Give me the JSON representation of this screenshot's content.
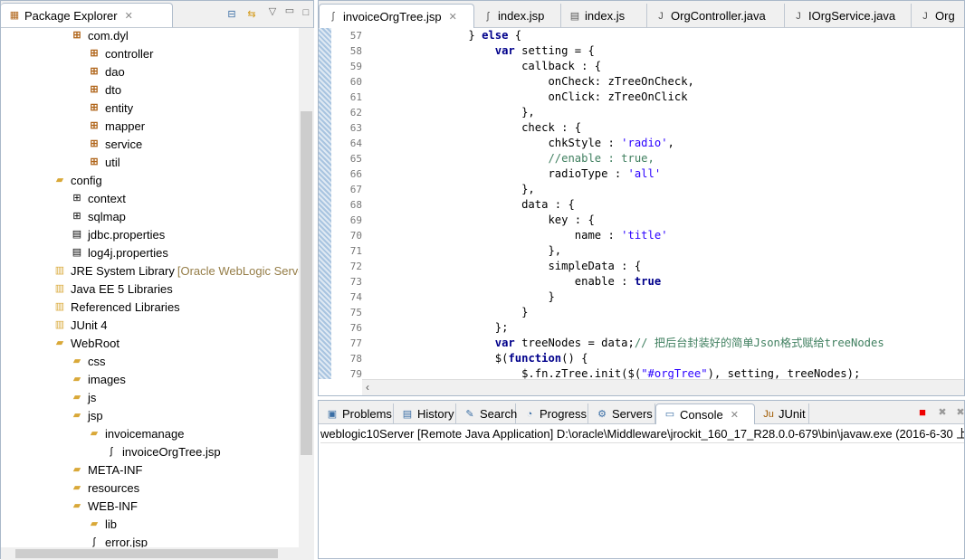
{
  "explorer": {
    "title": "Package Explorer",
    "items": [
      {
        "label": "com.dyl",
        "icon": "package-warning-icon",
        "level": 2
      },
      {
        "label": "controller",
        "icon": "package-icon",
        "level": 3
      },
      {
        "label": "dao",
        "icon": "package-warning-icon",
        "level": 3
      },
      {
        "label": "dto",
        "icon": "package-icon",
        "level": 3
      },
      {
        "label": "entity",
        "icon": "package-icon",
        "level": 3
      },
      {
        "label": "mapper",
        "icon": "package-icon",
        "level": 3
      },
      {
        "label": "service",
        "icon": "package-warning-icon",
        "level": 3
      },
      {
        "label": "util",
        "icon": "package-icon",
        "level": 3
      },
      {
        "label": "config",
        "icon": "source-folder-icon",
        "level": 1
      },
      {
        "label": "context",
        "icon": "folder-package-icon",
        "level": 2
      },
      {
        "label": "sqlmap",
        "icon": "folder-package-icon",
        "level": 2
      },
      {
        "label": "jdbc.properties",
        "icon": "properties-file-icon",
        "level": 2
      },
      {
        "label": "log4j.properties",
        "icon": "properties-file-icon",
        "level": 2
      },
      {
        "label": "JRE System Library",
        "suffix": "[Oracle WebLogic Serve",
        "icon": "library-icon",
        "level": 1
      },
      {
        "label": "Java EE 5 Libraries",
        "icon": "library-icon",
        "level": 1
      },
      {
        "label": "Referenced Libraries",
        "icon": "library-icon",
        "level": 1
      },
      {
        "label": "JUnit 4",
        "icon": "library-icon",
        "level": 1
      },
      {
        "label": "WebRoot",
        "icon": "folder-icon",
        "level": 1
      },
      {
        "label": "css",
        "icon": "folder-icon",
        "level": 2
      },
      {
        "label": "images",
        "icon": "folder-icon",
        "level": 2
      },
      {
        "label": "js",
        "icon": "folder-icon",
        "level": 2
      },
      {
        "label": "jsp",
        "icon": "folder-icon",
        "level": 2
      },
      {
        "label": "invoicemanage",
        "icon": "folder-icon",
        "level": 3
      },
      {
        "label": "invoiceOrgTree.jsp",
        "icon": "jsp-file-icon",
        "level": 4
      },
      {
        "label": "META-INF",
        "icon": "folder-icon",
        "level": 2
      },
      {
        "label": "resources",
        "icon": "folder-icon",
        "level": 2
      },
      {
        "label": "WEB-INF",
        "icon": "folder-icon",
        "level": 2
      },
      {
        "label": "lib",
        "icon": "folder-icon",
        "level": 3
      },
      {
        "label": "error.jsp",
        "icon": "jsp-file-icon",
        "level": 3
      }
    ]
  },
  "editor": {
    "tabs": [
      "invoiceOrgTree.jsp",
      "index.jsp",
      "index.js",
      "OrgController.java",
      "IOrgService.java",
      "Org"
    ],
    "lines": [
      {
        "n": "57",
        "t": [
          [
            "                }",
            "p"
          ],
          [
            " else ",
            "k"
          ],
          [
            "{",
            "p"
          ]
        ]
      },
      {
        "n": "58",
        "t": [
          [
            "                    ",
            "p"
          ],
          [
            "var",
            "k"
          ],
          [
            " setting = {",
            "p"
          ]
        ]
      },
      {
        "n": "59",
        "t": [
          [
            "                        callback : {",
            "p"
          ]
        ]
      },
      {
        "n": "60",
        "t": [
          [
            "                            onCheck: zTreeOnCheck,",
            "p"
          ]
        ]
      },
      {
        "n": "61",
        "t": [
          [
            "                            onClick: zTreeOnClick",
            "p"
          ]
        ]
      },
      {
        "n": "62",
        "t": [
          [
            "                        },",
            "p"
          ]
        ]
      },
      {
        "n": "63",
        "t": [
          [
            "                        check : {",
            "p"
          ]
        ]
      },
      {
        "n": "64",
        "t": [
          [
            "                            chkStyle : ",
            "p"
          ],
          [
            "'radio'",
            "s"
          ],
          [
            ",",
            "p"
          ]
        ]
      },
      {
        "n": "65",
        "t": [
          [
            "                            //enable : true,",
            "c"
          ]
        ]
      },
      {
        "n": "66",
        "t": [
          [
            "                            radioType : ",
            "p"
          ],
          [
            "'all'",
            "s"
          ]
        ]
      },
      {
        "n": "67",
        "t": [
          [
            "                        },",
            "p"
          ]
        ]
      },
      {
        "n": "68",
        "t": [
          [
            "                        data : {",
            "p"
          ]
        ]
      },
      {
        "n": "69",
        "t": [
          [
            "                            key : {",
            "p"
          ]
        ]
      },
      {
        "n": "70",
        "t": [
          [
            "                                name : ",
            "p"
          ],
          [
            "'title'",
            "s"
          ]
        ]
      },
      {
        "n": "71",
        "t": [
          [
            "                            },",
            "p"
          ]
        ]
      },
      {
        "n": "72",
        "t": [
          [
            "                            simpleData : {",
            "p"
          ]
        ]
      },
      {
        "n": "73",
        "t": [
          [
            "                                enable : ",
            "p"
          ],
          [
            "true",
            "k"
          ]
        ]
      },
      {
        "n": "74",
        "t": [
          [
            "                            }",
            "p"
          ]
        ]
      },
      {
        "n": "75",
        "t": [
          [
            "                        }",
            "p"
          ]
        ]
      },
      {
        "n": "76",
        "t": [
          [
            "                    };",
            "p"
          ]
        ]
      },
      {
        "n": "77",
        "t": [
          [
            "                    ",
            "p"
          ],
          [
            "var",
            "k"
          ],
          [
            " treeNodes = data;",
            "p"
          ],
          [
            "// 把后台封装好的简单Json格式赋给treeNodes",
            "c"
          ]
        ]
      },
      {
        "n": "78",
        "t": [
          [
            "                    $(",
            "p"
          ],
          [
            "function",
            "k"
          ],
          [
            "() {",
            "p"
          ]
        ]
      },
      {
        "n": "79",
        "t": [
          [
            "                        $.fn.zTree.init($(",
            "p"
          ],
          [
            "\"#orgTree\"",
            "s"
          ],
          [
            "), setting, treeNodes);",
            "p"
          ]
        ]
      }
    ]
  },
  "console": {
    "tabs": [
      "Problems",
      "History",
      "Search",
      "Progress",
      "Servers",
      "Console",
      "JUnit"
    ],
    "description": "weblogic10Server [Remote Java Application] D:\\oracle\\Middleware\\jrockit_160_17_R28.0.0-679\\bin\\javaw.exe (2016-6-30 上"
  },
  "colors": {
    "keyword": "#00008b",
    "string": "#2a00ff",
    "comment": "#3f7f5f",
    "package": "#b0651a"
  }
}
